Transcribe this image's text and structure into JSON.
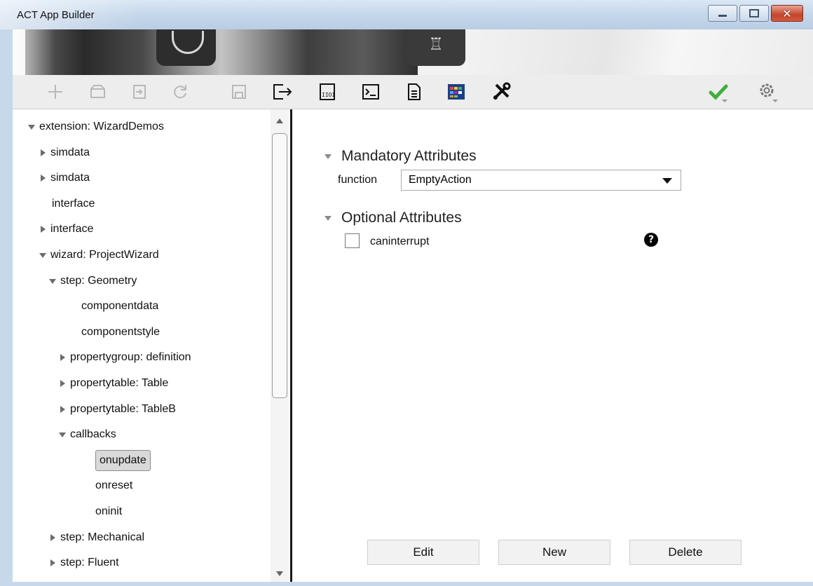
{
  "window": {
    "title": "ACT App Builder",
    "buttons": [
      "minimize",
      "maximize",
      "close"
    ]
  },
  "banner": {
    "tower_glyph": "♖"
  },
  "toolbar": {
    "items": [
      {
        "name": "add-icon",
        "enabled": false
      },
      {
        "name": "open-icon",
        "enabled": false
      },
      {
        "name": "import-icon",
        "enabled": false
      },
      {
        "name": "reload-icon",
        "enabled": false
      },
      {
        "name": "save-icon",
        "enabled": false
      },
      {
        "name": "export-icon",
        "enabled": true
      },
      {
        "name": "binary-icon",
        "enabled": true
      },
      {
        "name": "console-icon",
        "enabled": true
      },
      {
        "name": "document-icon",
        "enabled": true
      },
      {
        "name": "palette-icon",
        "enabled": true
      },
      {
        "name": "tools-icon",
        "enabled": true
      },
      {
        "name": "validate-check-icon",
        "enabled": true
      },
      {
        "name": "settings-gear-icon",
        "enabled": true
      }
    ],
    "colors": {
      "check": "#3fae3f"
    }
  },
  "tree": {
    "nodes": [
      {
        "label": "extension: WizardDemos",
        "toggle": "expanded"
      },
      {
        "label": "simdata",
        "toggle": "collapsed"
      },
      {
        "label": "simdata",
        "toggle": "collapsed"
      },
      {
        "label": "interface",
        "toggle": "none"
      },
      {
        "label": "interface",
        "toggle": "collapsed"
      },
      {
        "label": "wizard: ProjectWizard",
        "toggle": "expanded"
      },
      {
        "label": "step: Geometry",
        "toggle": "expanded"
      },
      {
        "label": "componentdata",
        "toggle": "none"
      },
      {
        "label": "componentstyle",
        "toggle": "none"
      },
      {
        "label": "propertygroup: definition",
        "toggle": "collapsed"
      },
      {
        "label": "propertytable: Table",
        "toggle": "collapsed"
      },
      {
        "label": "propertytable: TableB",
        "toggle": "collapsed"
      },
      {
        "label": "callbacks",
        "toggle": "expanded"
      },
      {
        "label": "onupdate",
        "toggle": "none",
        "selected": true
      },
      {
        "label": "onreset",
        "toggle": "none"
      },
      {
        "label": "oninit",
        "toggle": "none"
      },
      {
        "label": "step: Mechanical",
        "toggle": "collapsed"
      },
      {
        "label": "step: Fluent",
        "toggle": "collapsed"
      }
    ]
  },
  "details": {
    "mandatory": {
      "heading": "Mandatory Attributes",
      "function_label": "function",
      "function_value": "EmptyAction"
    },
    "optional": {
      "heading": "Optional Attributes",
      "caninterrupt_label": "caninterrupt",
      "caninterrupt_checked": false,
      "help_glyph": "?"
    },
    "buttons": {
      "edit": "Edit",
      "new": "New",
      "delete": "Delete"
    }
  }
}
